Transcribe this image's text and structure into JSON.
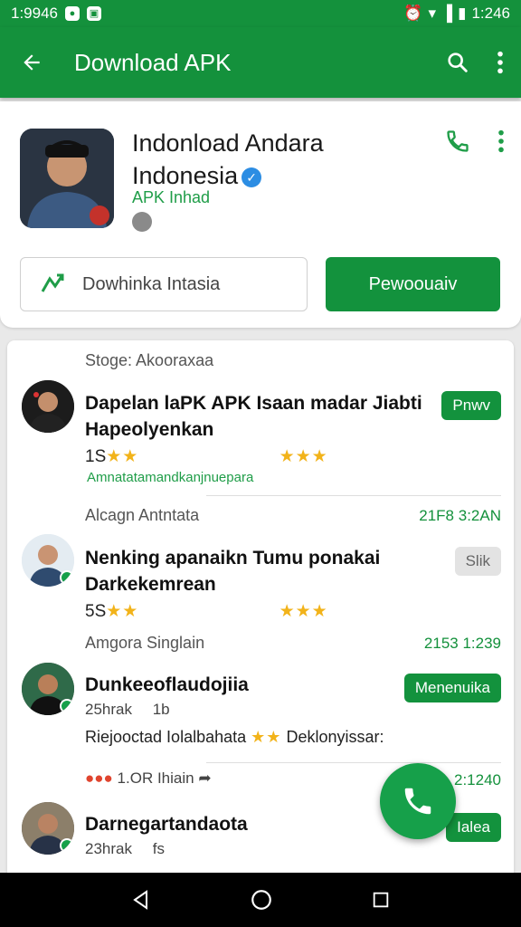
{
  "status_bar": {
    "time": "1:9946",
    "right_time": "1:246"
  },
  "app_bar": {
    "title": "Download APK"
  },
  "profile": {
    "title_line1": "Indonload Andara",
    "title_line2": "Indonesia",
    "subtitle": "APK Inhad",
    "outline_button": "Dowhinka Intasia",
    "primary_button": "Pewoouaiv"
  },
  "list": {
    "store_label": "Stoge: Akooraxaa",
    "items": [
      {
        "title": "Dapelan laPK APK Isaan madar Jiabti Hapeolyenkan",
        "pill": "Pnwv",
        "rating_prefix": "1S",
        "link": "Amnatatamandkanjnuepara"
      },
      {
        "section": "Alcagn Antntata",
        "time": "21F8 3:2AN",
        "title": "Nenking apanaikn Tumu ponakai Darkekemrean",
        "pill": "Slik",
        "rating_prefix": "5S"
      },
      {
        "section": "Amgora Singlain",
        "time": "2153 1:239",
        "title": "Dunkeeoflaudojiia",
        "pill": "Menenuika",
        "meta_left": "25hrak",
        "meta_right": "1b",
        "desc_left": "Riejooctad Iolalbahata",
        "desc_right": "Deklonyissar:",
        "reaction_count": "1.OR Ihiain",
        "time2": "2:1240"
      },
      {
        "title": "Darnegartandaota",
        "meta_left": "23hrak",
        "meta_right": "fs",
        "pill": "Ialea"
      }
    ]
  },
  "colors": {
    "primary": "#14913c",
    "accent": "#f2b31a"
  }
}
